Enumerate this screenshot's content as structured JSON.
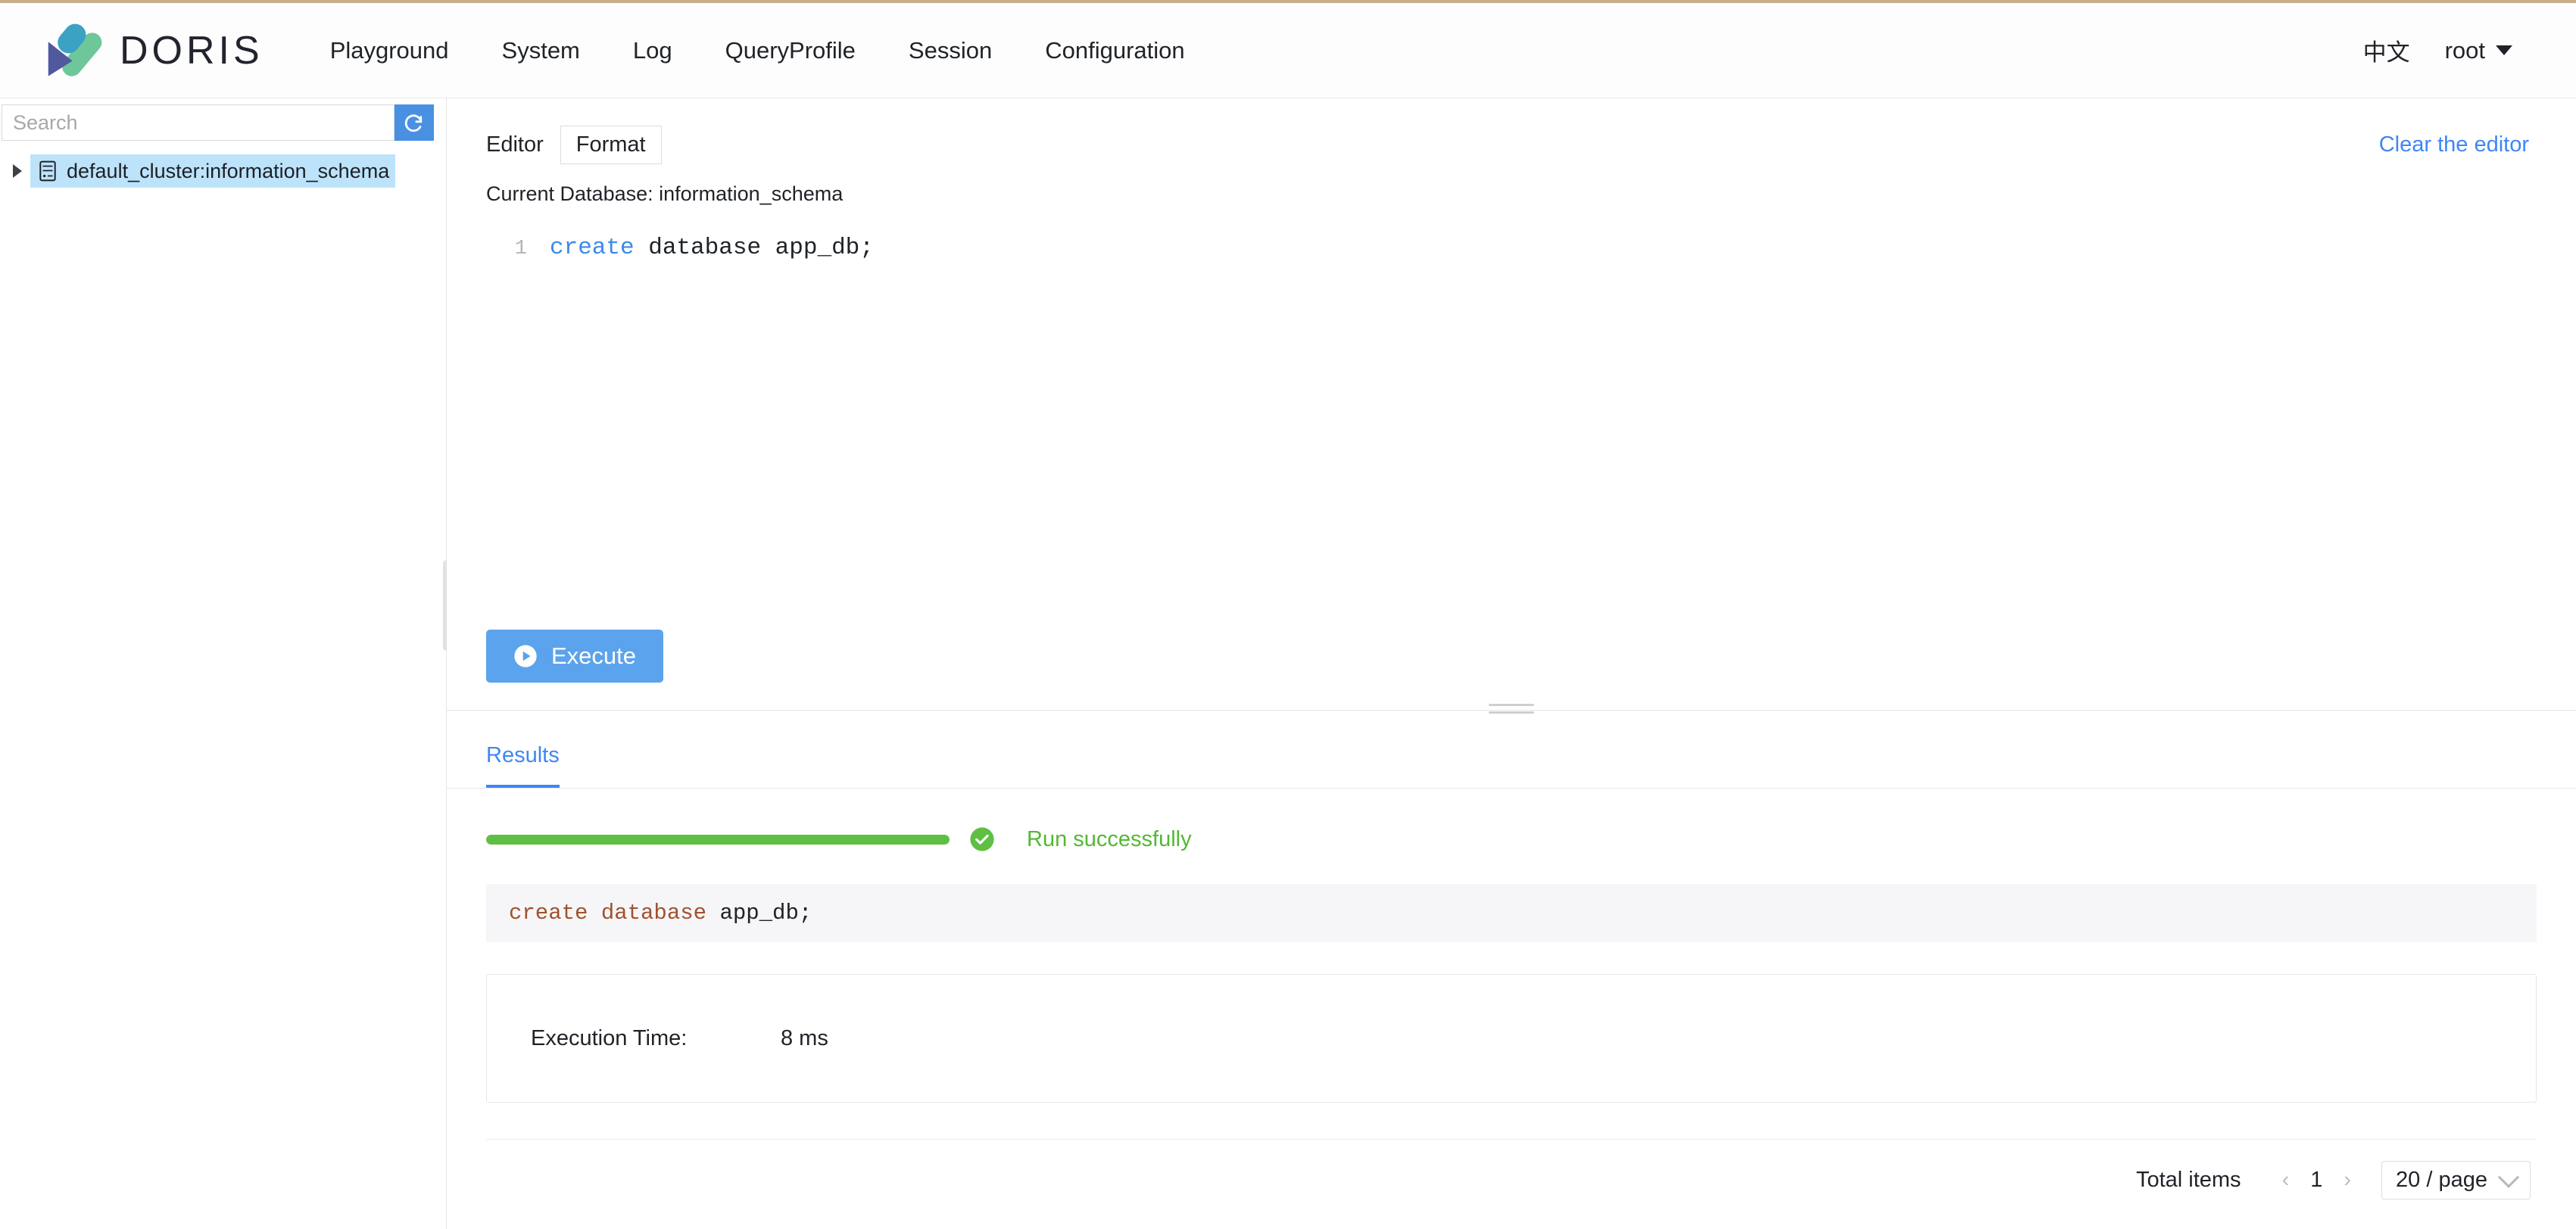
{
  "app": {
    "brand_name": "DORIS",
    "logo_icon": "doris-logo-icon",
    "accent_blue": "#3d87f5",
    "success_green": "#52b832",
    "top_strip_color": "#c9ad8a"
  },
  "header": {
    "nav": [
      {
        "label": "Playground"
      },
      {
        "label": "System"
      },
      {
        "label": "Log"
      },
      {
        "label": "QueryProfile"
      },
      {
        "label": "Session"
      },
      {
        "label": "Configuration"
      }
    ],
    "language_toggle": "中文",
    "user_name": "root",
    "user_caret_icon": "caret-down-icon"
  },
  "sidebar": {
    "search": {
      "placeholder": "Search",
      "value": "",
      "refresh_icon": "refresh-icon"
    },
    "tree": [
      {
        "expand_icon": "triangle-right-icon",
        "node_icon": "database-icon",
        "label": "default_cluster:information_schema",
        "selected": true
      }
    ]
  },
  "editor": {
    "tab_label": "Editor",
    "format_button": "Format",
    "clear_link": "Clear the editor",
    "current_database": "Current Database: information_schema",
    "code": {
      "line_number": "1",
      "keyword": "create",
      "rest": " database app_db;"
    },
    "execute_button": "Execute",
    "execute_icon": "play-circle-icon"
  },
  "results": {
    "tab_label": "Results",
    "progress_percent": 100,
    "status_icon": "check-circle-icon",
    "status_text": "Run successfully",
    "sql_echo": {
      "keyword": "create database",
      "rest": " app_db;"
    },
    "detail": {
      "label": "Execution Time:",
      "value": "8 ms"
    },
    "pagination": {
      "total_label": "Total items",
      "prev_icon": "chevron-left-icon",
      "current_page": "1",
      "next_icon": "chevron-right-icon",
      "page_size": "20 / page",
      "page_size_caret": "chevron-down-icon"
    }
  }
}
